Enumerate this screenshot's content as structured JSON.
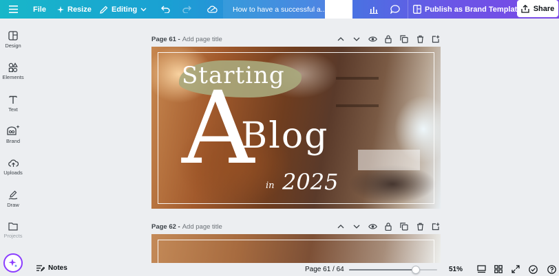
{
  "topbar": {
    "file_label": "File",
    "resize_label": "Resize",
    "editing_label": "Editing",
    "doc_title": "How to have a successful a...",
    "publish_label": "Publish as Brand Template",
    "share_label": "Share"
  },
  "sidebar": {
    "items": [
      {
        "label": "Design",
        "icon": "design-icon"
      },
      {
        "label": "Elements",
        "icon": "elements-icon"
      },
      {
        "label": "Text",
        "icon": "text-icon"
      },
      {
        "label": "Brand",
        "icon": "brand-icon"
      },
      {
        "label": "Uploads",
        "icon": "uploads-icon"
      },
      {
        "label": "Draw",
        "icon": "draw-icon"
      },
      {
        "label": "Projects",
        "icon": "projects-icon"
      }
    ]
  },
  "pages": [
    {
      "number": "Page 61 -",
      "title_placeholder": "Add page title"
    },
    {
      "number": "Page 62 -",
      "title_placeholder": "Add page title"
    }
  ],
  "design": {
    "line1": "Starting",
    "big_letter": "A",
    "line2": "Blog",
    "in_text": "in",
    "year": "2025"
  },
  "bottombar": {
    "notes_label": "Notes",
    "pager": "Page 61 / 64",
    "zoom_pct": "51%",
    "zoom_level": 0.51
  },
  "colors": {
    "accent_purple": "#8b3dff",
    "topbar_start": "#18b7c9",
    "topbar_end": "#7b47e6"
  }
}
